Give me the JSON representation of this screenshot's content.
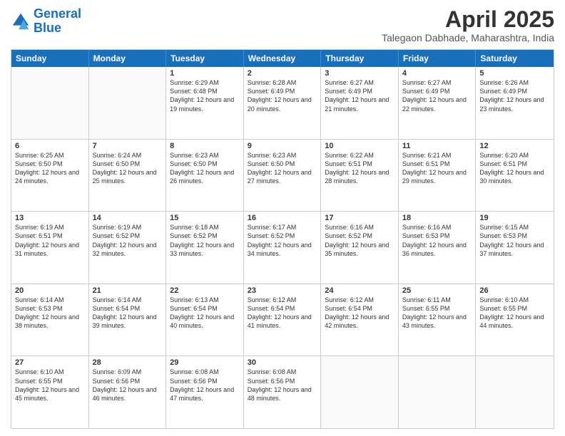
{
  "logo": {
    "line1": "General",
    "line2": "Blue"
  },
  "title": "April 2025",
  "subtitle": "Talegaon Dabhade, Maharashtra, India",
  "header_days": [
    "Sunday",
    "Monday",
    "Tuesday",
    "Wednesday",
    "Thursday",
    "Friday",
    "Saturday"
  ],
  "rows": [
    [
      {
        "day": "",
        "info": ""
      },
      {
        "day": "",
        "info": ""
      },
      {
        "day": "1",
        "info": "Sunrise: 6:29 AM\nSunset: 6:48 PM\nDaylight: 12 hours and 19 minutes."
      },
      {
        "day": "2",
        "info": "Sunrise: 6:28 AM\nSunset: 6:49 PM\nDaylight: 12 hours and 20 minutes."
      },
      {
        "day": "3",
        "info": "Sunrise: 6:27 AM\nSunset: 6:49 PM\nDaylight: 12 hours and 21 minutes."
      },
      {
        "day": "4",
        "info": "Sunrise: 6:27 AM\nSunset: 6:49 PM\nDaylight: 12 hours and 22 minutes."
      },
      {
        "day": "5",
        "info": "Sunrise: 6:26 AM\nSunset: 6:49 PM\nDaylight: 12 hours and 23 minutes."
      }
    ],
    [
      {
        "day": "6",
        "info": "Sunrise: 6:25 AM\nSunset: 6:50 PM\nDaylight: 12 hours and 24 minutes."
      },
      {
        "day": "7",
        "info": "Sunrise: 6:24 AM\nSunset: 6:50 PM\nDaylight: 12 hours and 25 minutes."
      },
      {
        "day": "8",
        "info": "Sunrise: 6:23 AM\nSunset: 6:50 PM\nDaylight: 12 hours and 26 minutes."
      },
      {
        "day": "9",
        "info": "Sunrise: 6:23 AM\nSunset: 6:50 PM\nDaylight: 12 hours and 27 minutes."
      },
      {
        "day": "10",
        "info": "Sunrise: 6:22 AM\nSunset: 6:51 PM\nDaylight: 12 hours and 28 minutes."
      },
      {
        "day": "11",
        "info": "Sunrise: 6:21 AM\nSunset: 6:51 PM\nDaylight: 12 hours and 29 minutes."
      },
      {
        "day": "12",
        "info": "Sunrise: 6:20 AM\nSunset: 6:51 PM\nDaylight: 12 hours and 30 minutes."
      }
    ],
    [
      {
        "day": "13",
        "info": "Sunrise: 6:19 AM\nSunset: 6:51 PM\nDaylight: 12 hours and 31 minutes."
      },
      {
        "day": "14",
        "info": "Sunrise: 6:19 AM\nSunset: 6:52 PM\nDaylight: 12 hours and 32 minutes."
      },
      {
        "day": "15",
        "info": "Sunrise: 6:18 AM\nSunset: 6:52 PM\nDaylight: 12 hours and 33 minutes."
      },
      {
        "day": "16",
        "info": "Sunrise: 6:17 AM\nSunset: 6:52 PM\nDaylight: 12 hours and 34 minutes."
      },
      {
        "day": "17",
        "info": "Sunrise: 6:16 AM\nSunset: 6:52 PM\nDaylight: 12 hours and 35 minutes."
      },
      {
        "day": "18",
        "info": "Sunrise: 6:16 AM\nSunset: 6:53 PM\nDaylight: 12 hours and 36 minutes."
      },
      {
        "day": "19",
        "info": "Sunrise: 6:15 AM\nSunset: 6:53 PM\nDaylight: 12 hours and 37 minutes."
      }
    ],
    [
      {
        "day": "20",
        "info": "Sunrise: 6:14 AM\nSunset: 6:53 PM\nDaylight: 12 hours and 38 minutes."
      },
      {
        "day": "21",
        "info": "Sunrise: 6:14 AM\nSunset: 6:54 PM\nDaylight: 12 hours and 39 minutes."
      },
      {
        "day": "22",
        "info": "Sunrise: 6:13 AM\nSunset: 6:54 PM\nDaylight: 12 hours and 40 minutes."
      },
      {
        "day": "23",
        "info": "Sunrise: 6:12 AM\nSunset: 6:54 PM\nDaylight: 12 hours and 41 minutes."
      },
      {
        "day": "24",
        "info": "Sunrise: 6:12 AM\nSunset: 6:54 PM\nDaylight: 12 hours and 42 minutes."
      },
      {
        "day": "25",
        "info": "Sunrise: 6:11 AM\nSunset: 6:55 PM\nDaylight: 12 hours and 43 minutes."
      },
      {
        "day": "26",
        "info": "Sunrise: 6:10 AM\nSunset: 6:55 PM\nDaylight: 12 hours and 44 minutes."
      }
    ],
    [
      {
        "day": "27",
        "info": "Sunrise: 6:10 AM\nSunset: 6:55 PM\nDaylight: 12 hours and 45 minutes."
      },
      {
        "day": "28",
        "info": "Sunrise: 6:09 AM\nSunset: 6:56 PM\nDaylight: 12 hours and 46 minutes."
      },
      {
        "day": "29",
        "info": "Sunrise: 6:08 AM\nSunset: 6:56 PM\nDaylight: 12 hours and 47 minutes."
      },
      {
        "day": "30",
        "info": "Sunrise: 6:08 AM\nSunset: 6:56 PM\nDaylight: 12 hours and 48 minutes."
      },
      {
        "day": "",
        "info": ""
      },
      {
        "day": "",
        "info": ""
      },
      {
        "day": "",
        "info": ""
      }
    ]
  ]
}
